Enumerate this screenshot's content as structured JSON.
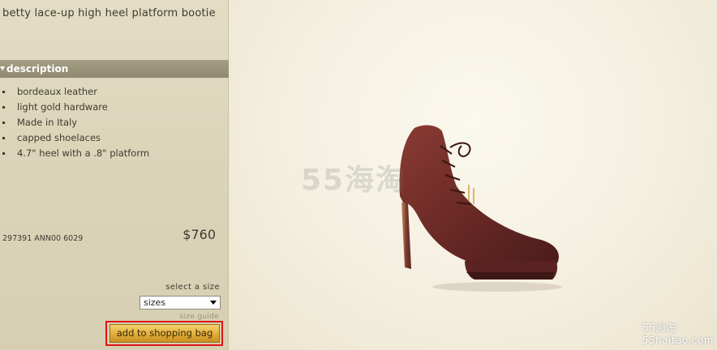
{
  "product": {
    "title": "betty lace-up high heel platform bootie",
    "description_header": "description",
    "description_items": [
      "bordeaux leather",
      "light gold hardware",
      "Made in Italy",
      "capped shoelaces",
      "4.7\" heel with a .8\" platform"
    ],
    "sku": "297391 ANN00 6029",
    "price": "$760"
  },
  "purchase": {
    "size_label": "select a size",
    "size_selected": "sizes",
    "size_guide": "size guide",
    "add_to_bag": "add to shopping bag"
  },
  "image": {
    "watermark_center": "55海淘",
    "watermark_bottom_1": "55海淘",
    "watermark_bottom_2": "55haitao.com",
    "shoe_color": "#6b2a26"
  }
}
